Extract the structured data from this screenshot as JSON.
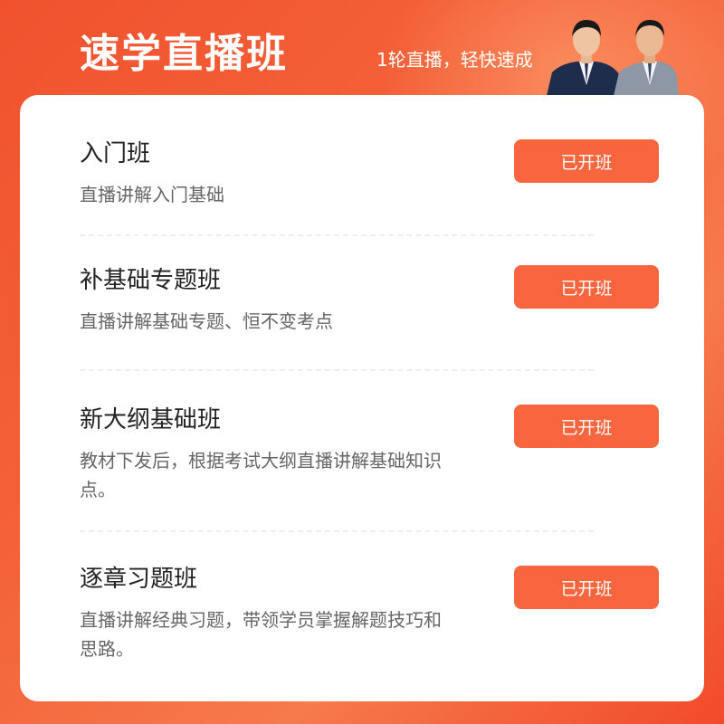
{
  "header": {
    "title": "速学直播班",
    "slogan": "1轮直播，轻快速成"
  },
  "courses": [
    {
      "name": "入门班",
      "desc": "直播讲解入门基础",
      "button": "已开班"
    },
    {
      "name": "补基础专题班",
      "desc": "直播讲解基础专题、恒不变考点",
      "button": "已开班"
    },
    {
      "name": "新大纲基础班",
      "desc": "教材下发后，根据考试大纲直播讲解基础知识点。",
      "button": "已开班"
    },
    {
      "name": "逐章习题班",
      "desc": "直播讲解经典习题，带领学员掌握解题技巧和思路。",
      "button": "已开班"
    }
  ],
  "colors": {
    "brand": "#f0522e",
    "button": "#f7663f"
  }
}
